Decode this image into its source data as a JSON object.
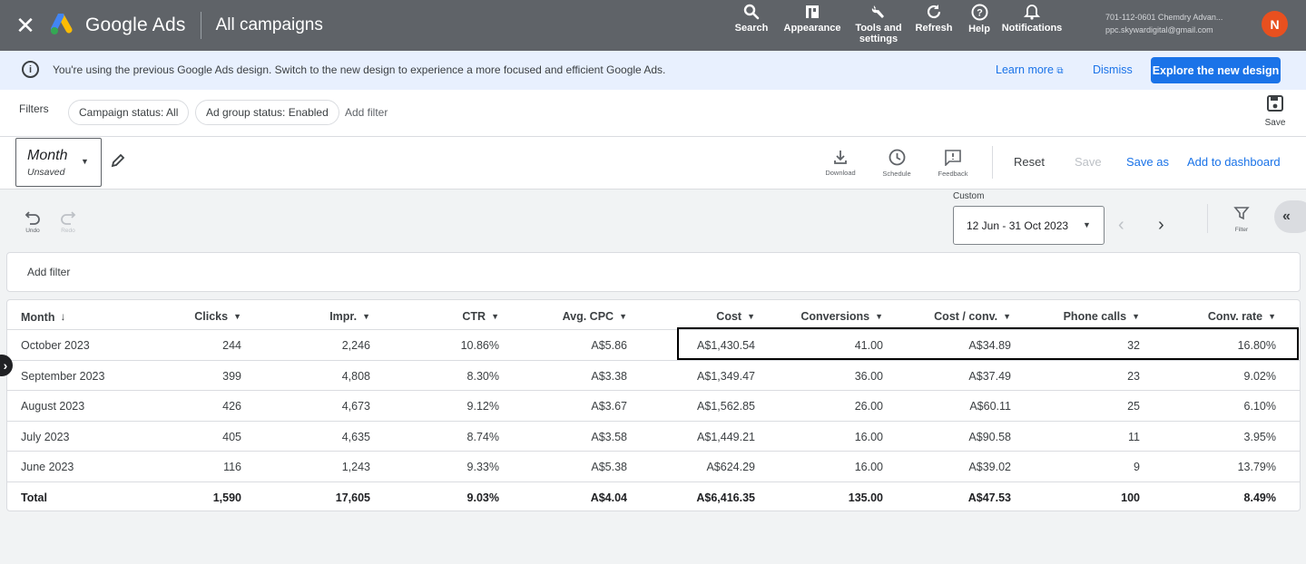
{
  "topbar": {
    "brand": "Google Ads",
    "title": "All campaigns",
    "actions": [
      {
        "label": "Search",
        "icon": "search-icon"
      },
      {
        "label": "Appearance",
        "icon": "appearance-icon"
      },
      {
        "label": "Tools and settings",
        "icon": "wrench-icon"
      },
      {
        "label": "Refresh",
        "icon": "refresh-icon"
      },
      {
        "label": "Help",
        "icon": "help-icon"
      },
      {
        "label": "Notifications",
        "icon": "bell-icon"
      }
    ],
    "account_line1": "701-112-0601 Chemdry Advan...",
    "account_line2": "ppc.skywardigital@gmail.com",
    "avatar_initial": "N"
  },
  "banner": {
    "text": "You're using the previous Google Ads design. Switch to the new design to experience a more focused and efficient Google Ads.",
    "learn_more": "Learn more",
    "dismiss": "Dismiss",
    "explore": "Explore the new design"
  },
  "filters": {
    "label": "Filters",
    "chips": [
      "Campaign status: All",
      "Ad group status: Enabled"
    ],
    "add_filter": "Add filter",
    "save": "Save"
  },
  "toolbar": {
    "segment_title": "Month",
    "segment_sub": "Unsaved",
    "download": "Download",
    "schedule": "Schedule",
    "feedback": "Feedback",
    "reset": "Reset",
    "save": "Save",
    "save_as": "Save as",
    "add_to_dashboard": "Add to dashboard"
  },
  "daterow": {
    "undo": "Undo",
    "redo": "Redo",
    "custom": "Custom",
    "range": "12 Jun - 31 Oct 2023",
    "filter": "Filter"
  },
  "add_filter_bar": "Add filter",
  "table": {
    "headers": [
      "Month",
      "Clicks",
      "Impr.",
      "CTR",
      "Avg. CPC",
      "Cost",
      "Conversions",
      "Cost / conv.",
      "Phone calls",
      "Conv. rate"
    ],
    "rows": [
      [
        "October 2023",
        "244",
        "2,246",
        "10.86%",
        "A$5.86",
        "A$1,430.54",
        "41.00",
        "A$34.89",
        "32",
        "16.80%"
      ],
      [
        "September 2023",
        "399",
        "4,808",
        "8.30%",
        "A$3.38",
        "A$1,349.47",
        "36.00",
        "A$37.49",
        "23",
        "9.02%"
      ],
      [
        "August 2023",
        "426",
        "4,673",
        "9.12%",
        "A$3.67",
        "A$1,562.85",
        "26.00",
        "A$60.11",
        "25",
        "6.10%"
      ],
      [
        "July 2023",
        "405",
        "4,635",
        "8.74%",
        "A$3.58",
        "A$1,449.21",
        "16.00",
        "A$90.58",
        "11",
        "3.95%"
      ],
      [
        "June 2023",
        "116",
        "1,243",
        "9.33%",
        "A$5.38",
        "A$624.29",
        "16.00",
        "A$39.02",
        "9",
        "13.79%"
      ]
    ],
    "total": [
      "Total",
      "1,590",
      "17,605",
      "9.03%",
      "A$4.04",
      "A$6,416.35",
      "135.00",
      "A$47.53",
      "100",
      "8.49%"
    ]
  },
  "colors": {
    "topbar": "#5f6368",
    "banner": "#e8f0fe",
    "accent": "#1a73e8",
    "avatar": "#e8501f"
  }
}
